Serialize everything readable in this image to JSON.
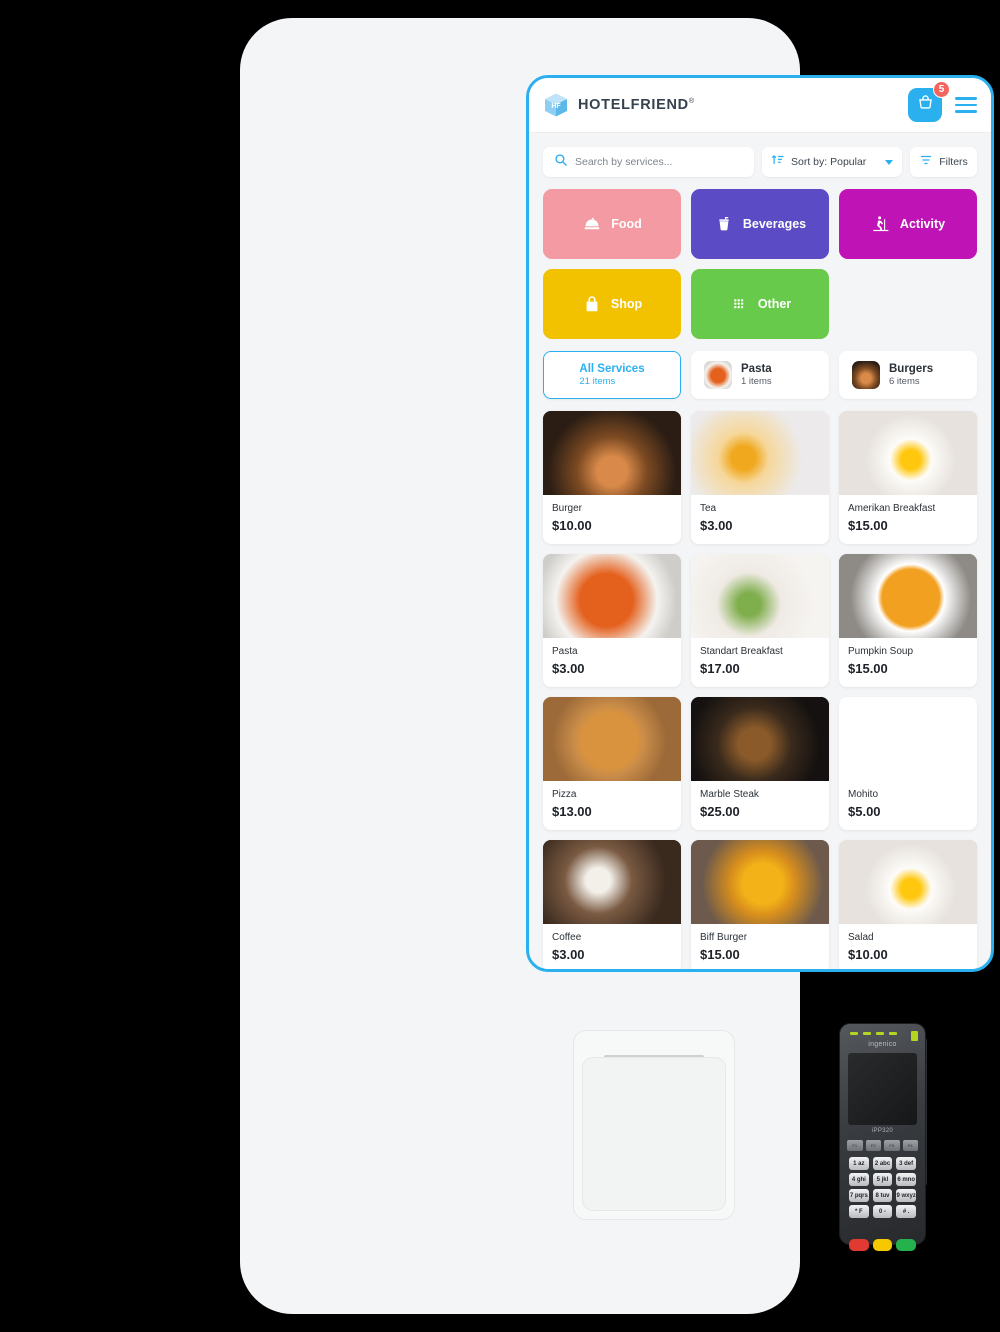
{
  "header": {
    "brand_name": "HOTELFRIEND",
    "brand_mark": "®",
    "cart_badge": "5",
    "cart_icon": "shopping-basket-icon",
    "menu_icon": "hamburger-menu-icon",
    "logo_icon": "hotelfriend-cube-logo"
  },
  "toolbar": {
    "search_placeholder": "Search by services...",
    "search_value": "",
    "search_icon": "search-icon",
    "sort_label": "Sort by: Popular",
    "sort_icon": "sort-ascending-icon",
    "filters_label": "Filters",
    "filters_icon": "filter-icon"
  },
  "categories": [
    {
      "label": "Food",
      "color": "#f49aa3",
      "icon": "food-dome-icon"
    },
    {
      "label": "Beverages",
      "color": "#5b4bc4",
      "icon": "drink-cup-icon"
    },
    {
      "label": "Activity",
      "color": "#bf13b5",
      "icon": "activity-hiker-icon"
    },
    {
      "label": "Shop",
      "color": "#f2c200",
      "icon": "shopping-bag-icon"
    },
    {
      "label": "Other",
      "color": "#68ca4b",
      "icon": "grid-dots-icon"
    }
  ],
  "service_tabs": [
    {
      "name": "All Services",
      "count": "21 items",
      "active": true,
      "thumb": ""
    },
    {
      "name": "Pasta",
      "count": "1 items",
      "active": false,
      "thumb": "pasta-thumb"
    },
    {
      "name": "Burgers",
      "count": "6 items",
      "active": false,
      "thumb": "burger-thumb"
    }
  ],
  "products": [
    {
      "name": "Burger",
      "price": "$10.00",
      "image": "burger-photo"
    },
    {
      "name": "Tea",
      "price": "$3.00",
      "image": "tea-photo"
    },
    {
      "name": "Amerikan Breakfast",
      "price": "$15.00",
      "image": "amerikan-breakfast-photo"
    },
    {
      "name": "Pasta",
      "price": "$3.00",
      "image": "pasta-photo"
    },
    {
      "name": "Standart Breakfast",
      "price": "$17.00",
      "image": "standart-breakfast-photo"
    },
    {
      "name": "Pumpkin Soup",
      "price": "$15.00",
      "image": "pumpkin-soup-photo"
    },
    {
      "name": "Pizza",
      "price": "$13.00",
      "image": "pizza-photo"
    },
    {
      "name": "Marble Steak",
      "price": "$25.00",
      "image": "marble-steak-photo"
    },
    {
      "name": "Mohito",
      "price": "$5.00",
      "image": "mohito-photo"
    },
    {
      "name": "Coffee",
      "price": "$3.00",
      "image": "coffee-photo"
    },
    {
      "name": "Biff Burger",
      "price": "$15.00",
      "image": "biff-burger-photo"
    },
    {
      "name": "Salad",
      "price": "$10.00",
      "image": "salad-photo"
    }
  ],
  "terminal": {
    "brand": "ingenico",
    "model": "iPP320",
    "function_keys": [
      "F1",
      "F2",
      "F3",
      "F4"
    ],
    "keypad": [
      "1 az",
      "2 abc",
      "3 def",
      "4 ghi",
      "5 jkl",
      "6 mno",
      "7 pqrs",
      "8 tuv",
      "9 wxyz",
      "* F",
      "0 -",
      "# ."
    ],
    "action_colors": [
      "#e03a32",
      "#f5c800",
      "#23b24b"
    ]
  },
  "colors": {
    "accent": "#2bb0ef",
    "badge": "#f4645f",
    "screen_bg": "#f4f5f6",
    "card_bg": "#ffffff"
  }
}
